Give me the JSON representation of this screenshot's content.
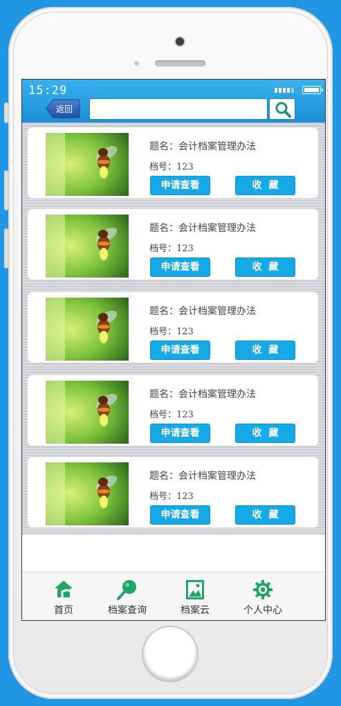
{
  "status_bar": {
    "time": "15:29"
  },
  "header": {
    "back_label": "返回",
    "search": {
      "value": "",
      "placeholder": ""
    }
  },
  "records": [
    {
      "title": "题名：会计档案管理办法",
      "number": "档号：123",
      "apply_label": "申请查看",
      "fav_label": "收藏"
    },
    {
      "title": "题名：会计档案管理办法",
      "number": "档号：123",
      "apply_label": "申请查看",
      "fav_label": "收藏"
    },
    {
      "title": "题名：会计档案管理办法",
      "number": "档号：123",
      "apply_label": "申请查看",
      "fav_label": "收藏"
    },
    {
      "title": "题名：会计档案管理办法",
      "number": "档号：123",
      "apply_label": "申请查看",
      "fav_label": "收藏"
    },
    {
      "title": "题名：会计档案管理办法",
      "number": "档号：123",
      "apply_label": "申请查看",
      "fav_label": "收藏"
    }
  ],
  "tabbar": {
    "items": [
      {
        "label": "首页",
        "icon": "home-icon"
      },
      {
        "label": "档案查询",
        "icon": "search-icon"
      },
      {
        "label": "档案云",
        "icon": "image-icon"
      },
      {
        "label": "个人中心",
        "icon": "gear-icon"
      }
    ]
  },
  "colors": {
    "accent": "#16a9e8",
    "header": "#2a9fe0",
    "tab_icon": "#1fa564",
    "background": "#2196e3"
  }
}
